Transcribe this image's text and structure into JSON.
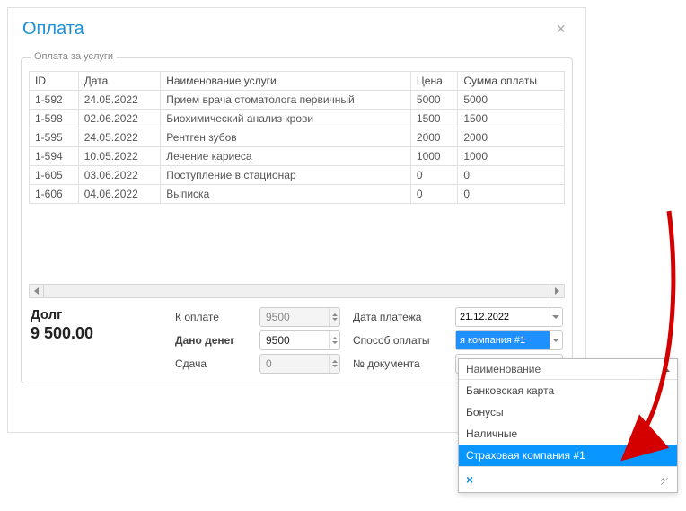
{
  "modal": {
    "title": "Оплата",
    "close_icon": "×"
  },
  "fieldset": {
    "legend": "Оплата за услуги"
  },
  "table": {
    "headers": {
      "id": "ID",
      "date": "Дата",
      "service": "Наименование услуги",
      "price": "Цена",
      "paid": "Сумма оплаты"
    },
    "rows": [
      {
        "id": "1-592",
        "date": "24.05.2022",
        "service": "Прием врача стоматолога первичный",
        "price": "5000",
        "paid": "5000"
      },
      {
        "id": "1-598",
        "date": "02.06.2022",
        "service": "Биохимический анализ крови",
        "price": "1500",
        "paid": "1500"
      },
      {
        "id": "1-595",
        "date": "24.05.2022",
        "service": "Рентген зубов",
        "price": "2000",
        "paid": "2000"
      },
      {
        "id": "1-594",
        "date": "10.05.2022",
        "service": "Лечение кариеса",
        "price": "1000",
        "paid": "1000"
      },
      {
        "id": "1-605",
        "date": "03.06.2022",
        "service": "Поступление в стационар",
        "price": "0",
        "paid": "0"
      },
      {
        "id": "1-606",
        "date": "04.06.2022",
        "service": "Выписка",
        "price": "0",
        "paid": "0"
      }
    ]
  },
  "totals": {
    "debt_label": "Долг",
    "debt_value": "9 500.00",
    "to_pay_label": "К оплате",
    "to_pay_value": "9500",
    "given_label": "Дано денег",
    "given_value": "9500",
    "change_label": "Сдача",
    "change_value": "0",
    "payment_date_label": "Дата платежа",
    "payment_date_value": "21.12.2022",
    "payment_method_label": "Способ оплаты",
    "payment_method_value": "я компания #1",
    "doc_number_label": "№ документа",
    "doc_number_value": ""
  },
  "footer": {
    "ok_label": " "
  },
  "dropdown": {
    "header": "Наименование",
    "items": [
      {
        "label": "Банковская карта",
        "selected": false
      },
      {
        "label": "Бонусы",
        "selected": false
      },
      {
        "label": "Наличные",
        "selected": false
      },
      {
        "label": "Страховая компания #1",
        "selected": true
      }
    ],
    "clear_icon": "×"
  }
}
